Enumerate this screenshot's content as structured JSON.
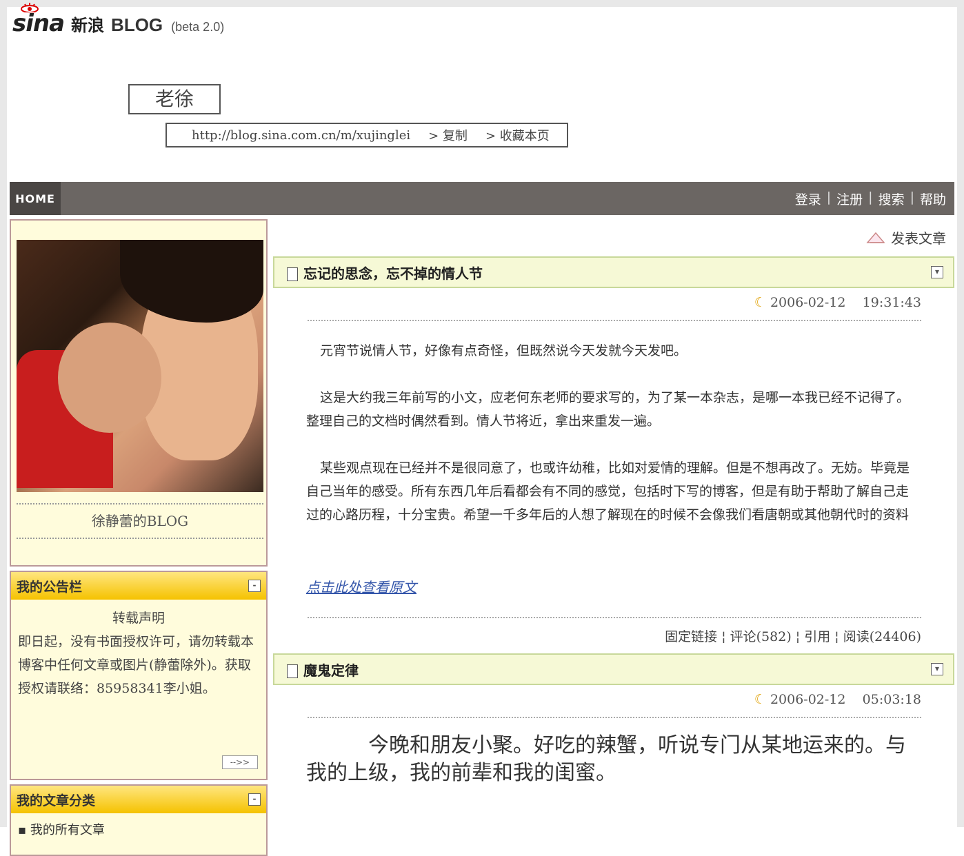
{
  "header": {
    "logo_mark": "sina",
    "logo_cn": "新浪",
    "logo_blog": "BLOG",
    "logo_beta": "(beta 2.0)",
    "blog_title": "老徐",
    "url": "http://blog.sina.com.cn/m/xujinglei",
    "copy": "> 复制",
    "bookmark": "> 收藏本页"
  },
  "nav": {
    "home": "HOME",
    "login": "登录",
    "register": "注册",
    "search": "搜索",
    "help": "帮助",
    "sep": "|"
  },
  "sidebar": {
    "owner": "徐静蕾的BLOG",
    "notice_title": "我的公告栏",
    "notice_heading": "转载声明",
    "notice_text": "即日起，没有书面授权许可，请勿转载本博客中任何文章或图片(静蕾除外)。获取授权请联络：85958341李小姐。",
    "more": "-->>",
    "cat_title": "我的文章分类",
    "cat_item": "我的所有文章",
    "collapse": "-"
  },
  "main": {
    "post_article": "发表文章",
    "articles": [
      {
        "title": "忘记的思念，忘不掉的情人节",
        "date": "2006-02-12",
        "time": "19:31:43",
        "paragraphs": [
          "元宵节说情人节，好像有点奇怪，但既然说今天发就今天发吧。",
          "这是大约我三年前写的小文，应老何东老师的要求写的，为了某一本杂志，是哪一本我已经不记得了。整理自己的文档时偶然看到。情人节将近，拿出来重发一遍。",
          "某些观点现在已经并不是很同意了，也或许幼稚，比如对爱情的理解。但是不想再改了。无妨。毕竟是自己当年的感受。所有东西几年后看都会有不同的感觉，包括时下写的博客，但是有助于帮助了解自己走过的心路历程，十分宝贵。希望一千多年后的人想了解现在的时候不会像我们看唐朝或其他朝代时的资料"
        ],
        "read_more": "点击此处查看原文",
        "permalink": "固定链接",
        "comments": "评论(582)",
        "trackback": "引用",
        "reads": "阅读(24406)"
      },
      {
        "title": "魔鬼定律",
        "date": "2006-02-12",
        "time": "05:03:18",
        "paragraphs": [
          "今晚和朋友小聚。好吃的辣蟹，听说专门从某地运来的。与我的上级，我的前辈和我的闺蜜。"
        ]
      }
    ]
  }
}
